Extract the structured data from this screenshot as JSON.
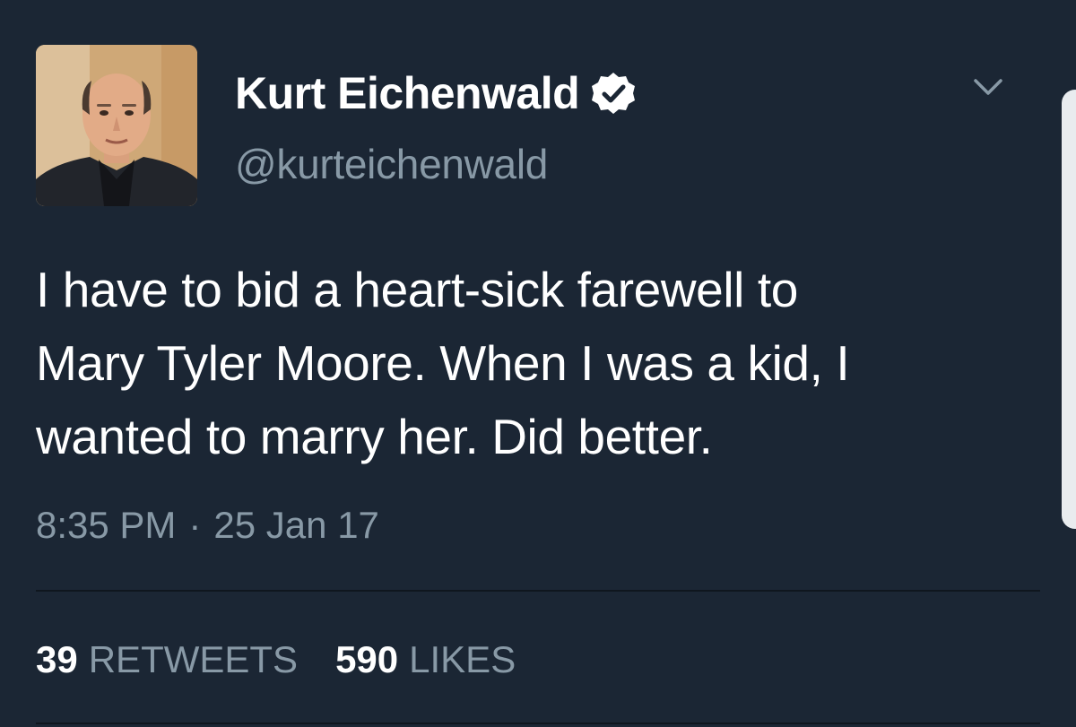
{
  "author": {
    "display_name": "Kurt Eichenwald",
    "handle": "@kurteichenwald",
    "verified": true,
    "verified_icon": "verified-badge-icon",
    "avatar": "profile-photo"
  },
  "tweet": {
    "text": "I have to bid a heart-sick farewell to\nMary Tyler Moore. When I was a kid, I\nwanted to marry her. Did better.",
    "time": "8:35 PM",
    "separator": "·",
    "date": "25 Jan 17"
  },
  "stats": {
    "retweets_count": "39",
    "retweets_label": "RETWEETS",
    "likes_count": "590",
    "likes_label": "LIKES"
  },
  "menu": {
    "icon": "chevron-down-icon"
  },
  "colors": {
    "background": "#1b2634",
    "primary_text": "#ffffff",
    "secondary_text": "#8899a6",
    "divider": "#0f161e"
  }
}
